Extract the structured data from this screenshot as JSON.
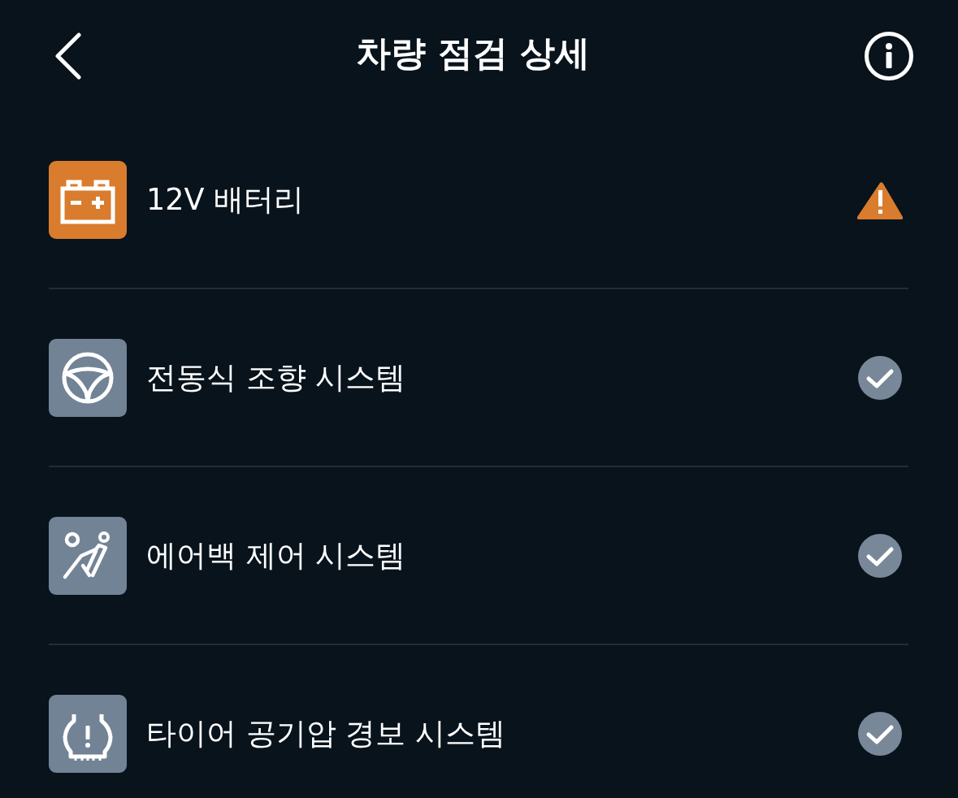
{
  "header": {
    "title": "차량 점검 상세"
  },
  "items": [
    {
      "kind": "battery",
      "label": "12V 배터리",
      "warning": true
    },
    {
      "kind": "steering",
      "label": "전동식 조향 시스템",
      "warning": false
    },
    {
      "kind": "airbag",
      "label": "에어백 제어 시스템",
      "warning": false
    },
    {
      "kind": "tire",
      "label": "타이어 공기압 경보 시스템",
      "warning": false
    }
  ]
}
